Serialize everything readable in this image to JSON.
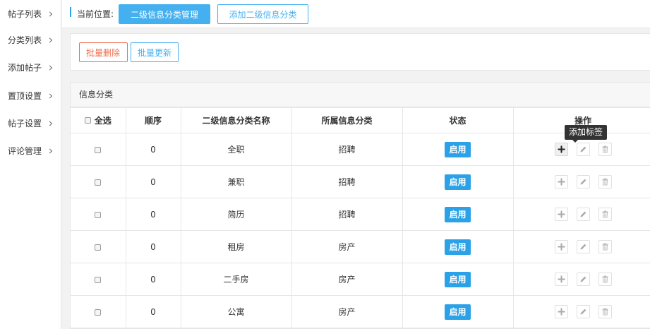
{
  "sidebar": {
    "items": [
      {
        "label": "帖子列表"
      },
      {
        "label": "分类列表"
      },
      {
        "label": "添加帖子"
      },
      {
        "label": "置顶设置"
      },
      {
        "label": "帖子设置"
      },
      {
        "label": "评论管理"
      }
    ]
  },
  "header": {
    "location_label": "当前位置:",
    "tabs": [
      {
        "label": "二级信息分类管理",
        "active": true
      },
      {
        "label": "添加二级信息分类",
        "active": false
      }
    ]
  },
  "actions": {
    "batch_delete": "批量删除",
    "batch_update": "批量更新"
  },
  "panel": {
    "title": "信息分类"
  },
  "table": {
    "columns": {
      "select_all": "全选",
      "order": "顺序",
      "name": "二级信息分类名称",
      "parent": "所属信息分类",
      "status": "状态",
      "actions": "操作"
    },
    "rows": [
      {
        "order": "0",
        "name": "全职",
        "parent": "招聘",
        "status": "启用"
      },
      {
        "order": "0",
        "name": "兼职",
        "parent": "招聘",
        "status": "启用"
      },
      {
        "order": "0",
        "name": "简历",
        "parent": "招聘",
        "status": "启用"
      },
      {
        "order": "0",
        "name": "租房",
        "parent": "房产",
        "status": "启用"
      },
      {
        "order": "0",
        "name": "二手房",
        "parent": "房产",
        "status": "启用"
      },
      {
        "order": "0",
        "name": "公寓",
        "parent": "房产",
        "status": "启用"
      }
    ]
  },
  "tooltip": {
    "text": "添加标签"
  },
  "icons": {
    "add": "plus-icon",
    "edit": "pencil-icon",
    "delete": "trash-icon"
  },
  "colors": {
    "primary": "#45b0f0",
    "status_badge": "#2ba1e7",
    "danger": "#ee6d4b"
  }
}
